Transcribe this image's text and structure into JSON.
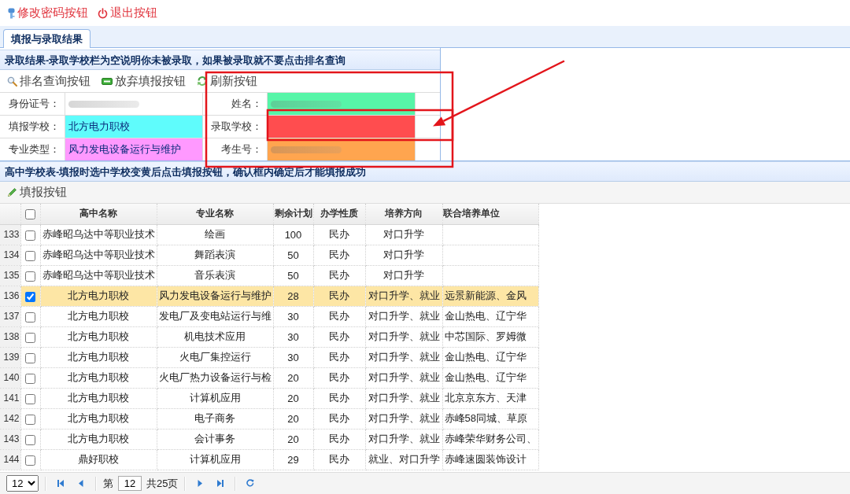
{
  "top_links": [
    {
      "kind": "password",
      "label": "修改密码按钮"
    },
    {
      "kind": "logout",
      "label": "退出按钮"
    }
  ],
  "tabs": [
    {
      "label": "填报与录取结果",
      "selected": true
    }
  ],
  "result_panel": {
    "title": "录取结果-录取学校栏为空说明你未被录取，如果被录取就不要点击排名查询",
    "right_half_outlined": true,
    "toolbar": [
      {
        "kind": "search",
        "label": "排名查询按钮"
      },
      {
        "kind": "abandon",
        "label": "放弃填报按钮"
      },
      {
        "kind": "refresh",
        "label": "刷新按钮"
      }
    ],
    "fields": [
      {
        "label": "身份证号：",
        "redacted": true,
        "outlined": false,
        "arrow": false
      },
      {
        "label": "姓名：",
        "redacted": true,
        "color": "#57f5a8",
        "outlined": false,
        "arrow": false
      },
      {
        "label": "填报学校：",
        "value": "北方电力职校",
        "redacted": false,
        "color": "#5ffcfc",
        "outlined": false,
        "arrow": false
      },
      {
        "label": "录取学校：",
        "redacted": false,
        "color": "#ff4d4f",
        "outlined": true,
        "arrow": true
      },
      {
        "label": "专业类型：",
        "value": "风力发电设备运行与维护",
        "redacted": false,
        "color": "#ff99ff",
        "outlined": false,
        "arrow": false
      },
      {
        "label": "考生号：",
        "redacted": true,
        "color": "#ffa54f",
        "outlined": false,
        "arrow": false
      }
    ]
  },
  "school_panel": {
    "title": "高中学校表-填报时选中学校变黄后点击填报按钮，确认框内确定后才能填报成功",
    "toolbar": [
      {
        "kind": "edit",
        "label": "填报按钮"
      }
    ],
    "table": {
      "all_checked": false,
      "columns": [
        "高中名称",
        "专业名称",
        "剩余计划",
        "办学性质",
        "培养方向",
        "联合培养单位"
      ],
      "rows": [
        {
          "number": "133",
          "selected": false,
          "checked": false,
          "cells": [
            "赤峰昭乌达中等职业技术",
            "绘画",
            "100",
            "民办",
            "对口升学"
          ]
        },
        {
          "number": "134",
          "selected": false,
          "checked": false,
          "cells": [
            "赤峰昭乌达中等职业技术",
            "舞蹈表演",
            "50",
            "民办",
            "对口升学"
          ]
        },
        {
          "number": "135",
          "selected": false,
          "checked": false,
          "cells": [
            "赤峰昭乌达中等职业技术",
            "音乐表演",
            "50",
            "民办",
            "对口升学"
          ]
        },
        {
          "number": "136",
          "selected": true,
          "checked": true,
          "cells": [
            "北方电力职校",
            "风力发电设备运行与维护",
            "28",
            "民办",
            "对口升学、就业",
            "远景新能源、金风"
          ]
        },
        {
          "number": "137",
          "selected": false,
          "checked": false,
          "cells": [
            "北方电力职校",
            "发电厂及变电站运行与维",
            "30",
            "民办",
            "对口升学、就业",
            "金山热电、辽宁华"
          ]
        },
        {
          "number": "138",
          "selected": false,
          "checked": false,
          "cells": [
            "北方电力职校",
            "机电技术应用",
            "30",
            "民办",
            "对口升学、就业",
            "中芯国际、罗姆微"
          ]
        },
        {
          "number": "139",
          "selected": false,
          "checked": false,
          "cells": [
            "北方电力职校",
            "火电厂集控运行",
            "30",
            "民办",
            "对口升学、就业",
            "金山热电、辽宁华"
          ]
        },
        {
          "number": "140",
          "selected": false,
          "checked": false,
          "cells": [
            "北方电力职校",
            "火电厂热力设备运行与检",
            "20",
            "民办",
            "对口升学、就业",
            "金山热电、辽宁华"
          ]
        },
        {
          "number": "141",
          "selected": false,
          "checked": false,
          "cells": [
            "北方电力职校",
            "计算机应用",
            "20",
            "民办",
            "对口升学、就业",
            "北京京东方、天津"
          ]
        },
        {
          "number": "142",
          "selected": false,
          "checked": false,
          "cells": [
            "北方电力职校",
            "电子商务",
            "20",
            "民办",
            "对口升学、就业",
            "赤峰58同城、草原"
          ]
        },
        {
          "number": "143",
          "selected": false,
          "checked": false,
          "cells": [
            "北方电力职校",
            "会计事务",
            "20",
            "民办",
            "对口升学、就业",
            "赤峰荣华财务公司、"
          ]
        },
        {
          "number": "144",
          "selected": false,
          "checked": false,
          "cells": [
            "鼎好职校",
            "计算机应用",
            "29",
            "民办",
            "就业、对口升学",
            "赤峰速圆装饰设计"
          ]
        }
      ]
    }
  },
  "pager": {
    "page_size": "12",
    "page_prefix": "第",
    "page": "12",
    "total": "共25页"
  }
}
